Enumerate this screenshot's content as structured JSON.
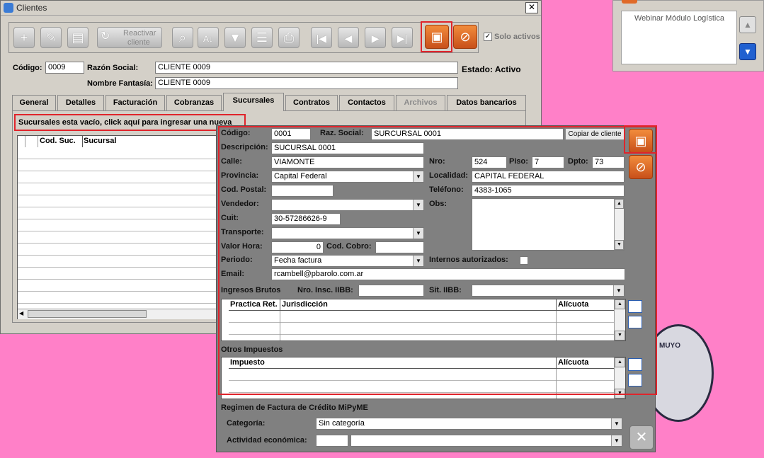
{
  "window": {
    "title": "Clientes",
    "close_glyph": "✕"
  },
  "toolbar": {
    "reactivar_line1": "Reactivar",
    "reactivar_line2": "cliente",
    "solo_activos_label": "Solo activos",
    "solo_activos_checked": true
  },
  "header": {
    "codigo_label": "Código:",
    "codigo_value": "0009",
    "razon_label": "Razón Social:",
    "razon_value": "CLIENTE 0009",
    "fantasia_label": "Nombre Fantasía:",
    "fantasia_value": "CLIENTE 0009",
    "estado_text": "Estado: Activo"
  },
  "tabs": [
    {
      "label": "General",
      "active": false,
      "disabled": false
    },
    {
      "label": "Detalles",
      "active": false,
      "disabled": false
    },
    {
      "label": "Facturación",
      "active": false,
      "disabled": false
    },
    {
      "label": "Cobranzas",
      "active": false,
      "disabled": false
    },
    {
      "label": "Sucursales",
      "active": true,
      "disabled": false
    },
    {
      "label": "Contratos",
      "active": false,
      "disabled": false
    },
    {
      "label": "Contactos",
      "active": false,
      "disabled": false
    },
    {
      "label": "Archivos",
      "active": false,
      "disabled": true
    },
    {
      "label": "Datos bancarios",
      "active": false,
      "disabled": false
    }
  ],
  "sucursales": {
    "empty_message": "Sucursales esta vacío, click aquí para ingresar una nueva",
    "columns": [
      "Cod. Suc.",
      "Sucursal"
    ]
  },
  "side_panel": {
    "webinar_item": "Webinar Módulo Logística"
  },
  "branch_form": {
    "codigo_label": "Código:",
    "codigo_value": "0001",
    "razsoc_label": "Raz. Social:",
    "razsoc_value": "SURCURSAL 0001",
    "copiar_button": "Copiar de cliente",
    "descripcion_label": "Descripción:",
    "descripcion_value": "SUCURSAL 0001",
    "calle_label": "Calle:",
    "calle_value": "VIAMONTE",
    "nro_label": "Nro:",
    "nro_value": "524",
    "piso_label": "Piso:",
    "piso_value": "7",
    "dpto_label": "Dpto:",
    "dpto_value": "73",
    "provincia_label": "Provincia:",
    "provincia_value": "Capital Federal",
    "localidad_label": "Localidad:",
    "localidad_value": "CAPITAL FEDERAL",
    "codpostal_label": "Cod. Postal:",
    "codpostal_value": "",
    "telefono_label": "Teléfono:",
    "telefono_value": "4383-1065",
    "vendedor_label": "Vendedor:",
    "vendedor_value": "",
    "obs_label": "Obs:",
    "obs_value": "",
    "cuit_label": "Cuit:",
    "cuit_value": "30-57286626-9",
    "transporte_label": "Transporte:",
    "transporte_value": "",
    "valorhora_label": "Valor Hora:",
    "valorhora_value": "0",
    "codcobro_label": "Cod. Cobro:",
    "codcobro_value": "",
    "periodo_label": "Periodo:",
    "periodo_value": "Fecha factura",
    "internos_label": "Internos autorizados:",
    "email_label": "Email:",
    "email_value": "rcambell@pbarolo.com.ar",
    "ingresos_label": "Ingresos Brutos",
    "nroinsc_label": "Nro. Insc. IIBB:",
    "nroinsc_value": "",
    "sitiibb_label": "Sit. IIBB:",
    "sitiibb_value": "",
    "retenciones_columns": [
      "Practica Ret.",
      "Jurisdicción",
      "Alícuota"
    ],
    "otros_label": "Otros Impuestos",
    "impuestos_columns": [
      "Impuesto",
      "Alícuota"
    ],
    "mipyme_label": "Regimen de Factura de Crédito MiPyME",
    "categoria_label": "Categoría:",
    "categoria_value": "Sin categoría",
    "actividad_label": "Actividad económica:",
    "actividad_code": "",
    "actividad_value": ""
  },
  "colors": {
    "accent_orange": "#e06a28",
    "highlight_red": "#e0242b",
    "background_pink": "#ff80c8"
  }
}
